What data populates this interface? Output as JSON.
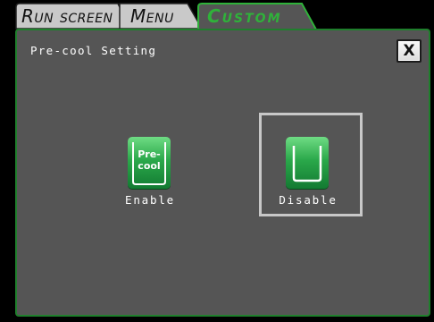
{
  "tabs": [
    {
      "label": "Run screen",
      "active": false
    },
    {
      "label": "Menu",
      "active": false
    },
    {
      "label": "Custom",
      "active": true
    }
  ],
  "panel": {
    "title": "Pre-cool Setting",
    "close_label": "X"
  },
  "options": [
    {
      "label": "Enable",
      "icon": "pre-cool-icon",
      "icon_text_line1": "Pre-",
      "icon_text_line2": "cool",
      "selected": false
    },
    {
      "label": "Disable",
      "icon": "empty-container-icon",
      "selected": true
    }
  ],
  "colors": {
    "panel_bg": "#555555",
    "accent_green": "#2fb23a",
    "border_green": "#1f7f2c",
    "selection_border": "#c8c8c8"
  }
}
